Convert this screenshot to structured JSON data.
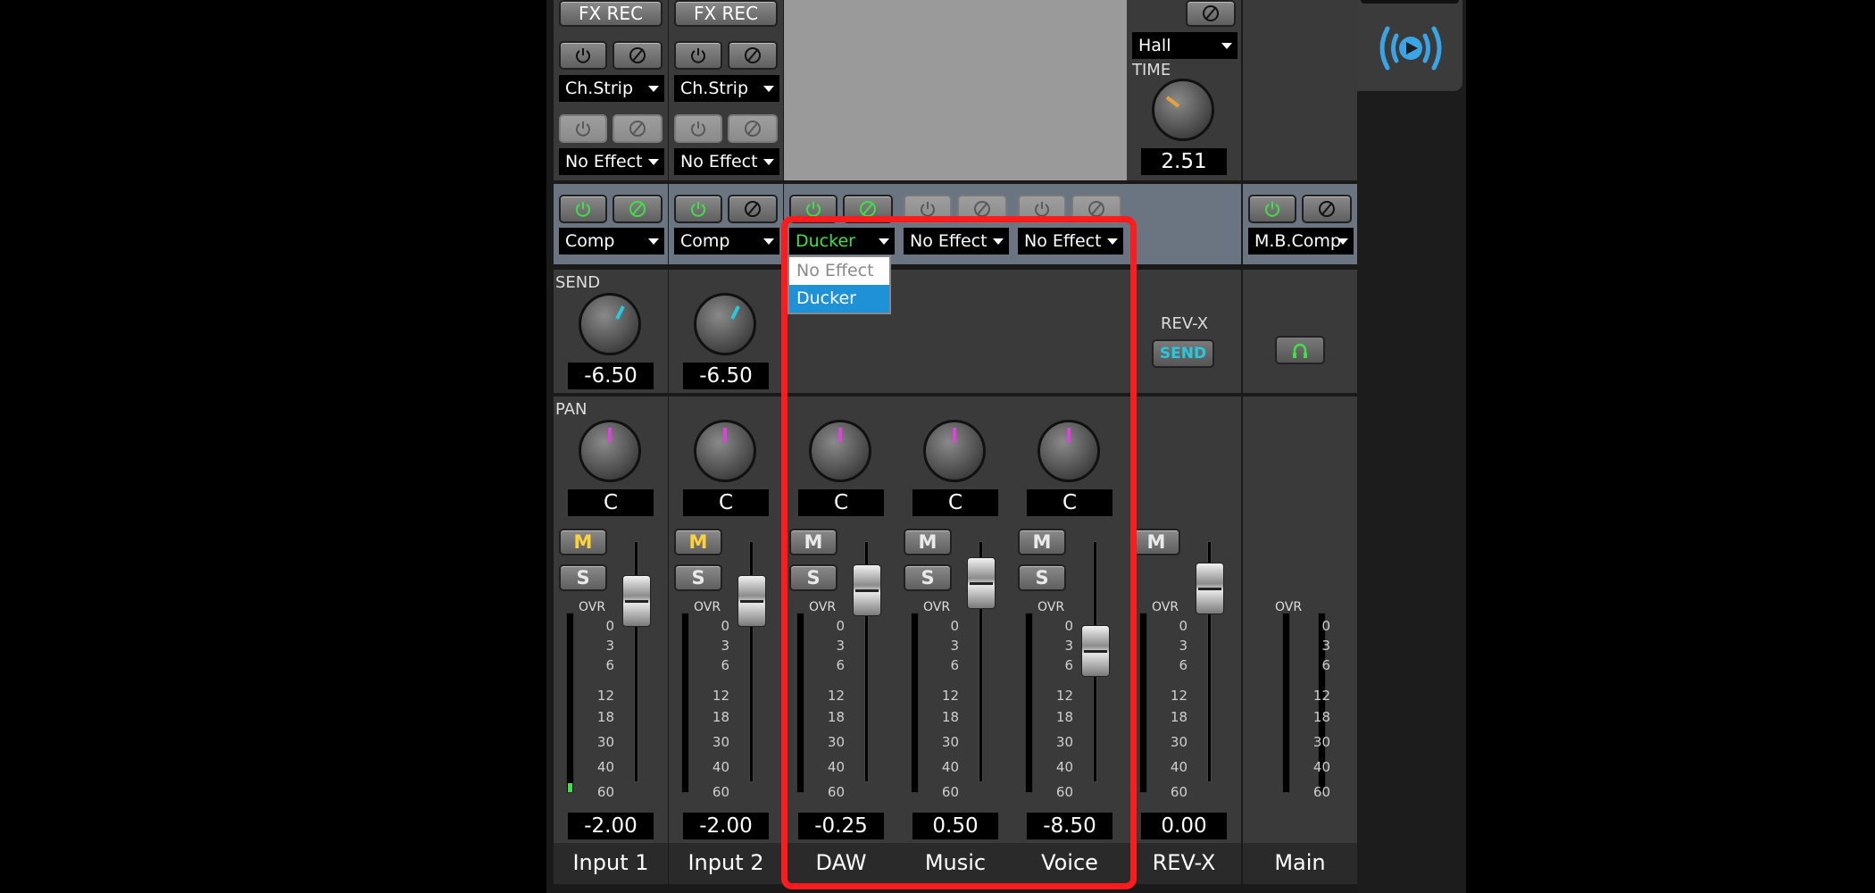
{
  "header_labels": {
    "fx_rec": "FX REC",
    "send": "SEND",
    "pan": "PAN",
    "time": "TIME",
    "ovr": "OVR",
    "revx": "REV-X",
    "send_button": "SEND"
  },
  "scale": [
    "0",
    "3",
    "6",
    "12",
    "18",
    "30",
    "40",
    "60"
  ],
  "reverb": {
    "type": "Hall",
    "time_value": "2.51"
  },
  "dropdown_popup": {
    "options": [
      "No Effect",
      "Ducker"
    ],
    "selected": "Ducker"
  },
  "channels": [
    {
      "name": "Input 1",
      "effect1": "Ch.Strip",
      "effect2": "No Effect",
      "dynamics": "Comp",
      "send": "-6.50",
      "pan": "C",
      "mute": "M",
      "mute_on": true,
      "solo": "S",
      "level": "-2.00"
    },
    {
      "name": "Input 2",
      "effect1": "Ch.Strip",
      "effect2": "No Effect",
      "dynamics": "Comp",
      "send": "-6.50",
      "pan": "C",
      "mute": "M",
      "mute_on": true,
      "solo": "S",
      "level": "-2.00"
    },
    {
      "name": "DAW",
      "dynamics": "Ducker",
      "pan": "C",
      "mute": "M",
      "solo": "S",
      "level": "-0.25"
    },
    {
      "name": "Music",
      "dynamics": "No Effect",
      "pan": "C",
      "mute": "M",
      "solo": "S",
      "level": "0.50"
    },
    {
      "name": "Voice",
      "dynamics": "No Effect",
      "pan": "C",
      "mute": "M",
      "solo": "S",
      "level": "-8.50"
    },
    {
      "name": "REV-X",
      "mute": "M",
      "level": "0.00"
    },
    {
      "name": "Main",
      "dynamics": "M.B.Comp"
    }
  ],
  "colors": {
    "accent_green": "#3fe046",
    "mute_yellow": "#ffd23a",
    "send_cyan": "#27c9e0",
    "pan_magenta": "#e040e0",
    "highlight_red": "#ff1b1b",
    "select_blue": "#1f91d6"
  }
}
